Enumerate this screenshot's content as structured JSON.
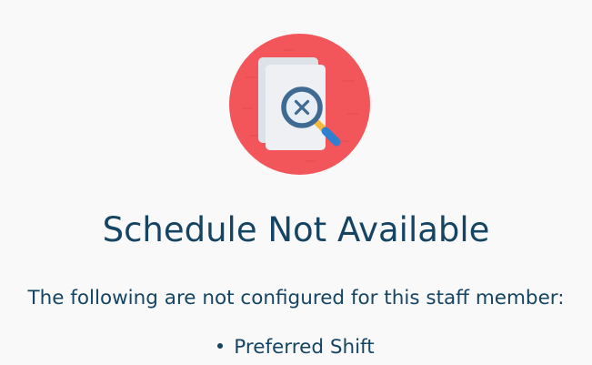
{
  "empty_state": {
    "icon": "document-search-error-icon",
    "title": "Schedule Not Available",
    "message": "The following are not configured for this staff member:",
    "missing_items": [
      "Preferred Shift"
    ]
  },
  "colors": {
    "circle": "#f2555a",
    "paper": "#eef0f4",
    "lens_ring": "#3f6a91",
    "handle": "#f6b93b",
    "handle_grip": "#2f80d0",
    "text": "#164564",
    "background": "#f9f9fa"
  }
}
